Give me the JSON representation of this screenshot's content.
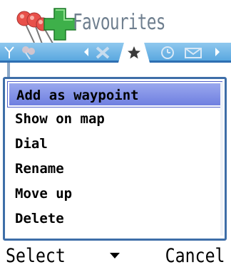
{
  "title": "Favourites",
  "menu": {
    "items": [
      {
        "label": "Add as waypoint",
        "selected": true
      },
      {
        "label": "Show on map",
        "selected": false
      },
      {
        "label": "Dial",
        "selected": false
      },
      {
        "label": "Rename",
        "selected": false
      },
      {
        "label": "Move up",
        "selected": false
      },
      {
        "label": "Delete",
        "selected": false
      }
    ]
  },
  "softkeys": {
    "left": "Select",
    "middle_icon": "chevron-down-icon",
    "right": "Cancel"
  },
  "tabs": {
    "active_icon": "star-icon",
    "icons": [
      "map-pins-icon",
      "cancel-x-icon",
      "star-icon",
      "clock-icon",
      "envelope-icon"
    ]
  },
  "colors": {
    "tab_strip": "#5aa8e0",
    "menu_border": "#3e6ea8",
    "selection": "#7f8fe6",
    "title_text": "#6f7f8f"
  }
}
